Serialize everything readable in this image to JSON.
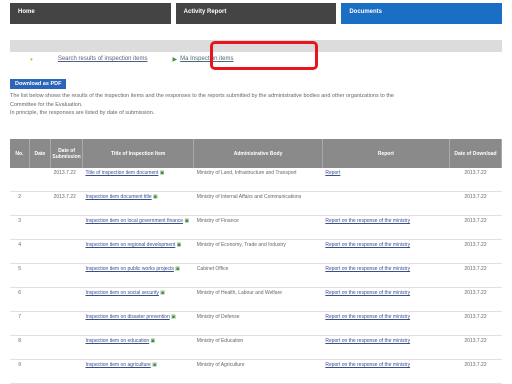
{
  "tabs": [
    {
      "label": "Home"
    },
    {
      "label": "Activity Report"
    },
    {
      "label": "Documents"
    }
  ],
  "links": {
    "link1": "Search results of inspection items",
    "link2": "Ma Inspection items"
  },
  "button": "Download as PDF",
  "desc": {
    "line1": "The list below shows the results of the inspection items and the responses to the reports submitted by the administrative bodies and other organizations to the",
    "line2": "Committee for the Evaluation.",
    "line3": "In principle, the responses are listed by date of submission."
  },
  "table": {
    "headers": [
      "No.",
      "Date",
      "Date of Submission",
      "Title of Inspection Item",
      "Administrative Body",
      "Report",
      "Date of Download"
    ],
    "rows": [
      {
        "no": "",
        "date": "",
        "dt": "2013.7.22",
        "title": "Title of inspection item document",
        "admin": "Ministry of Land, Infrastructure and Transport",
        "report": "Report",
        "dl": "2013.7.22"
      },
      {
        "no": "2",
        "date": "",
        "dt": "2013.7.22",
        "title": "Inspection item document title",
        "admin": "Ministry of Internal Affairs and Communications",
        "report": "",
        "dl": "2013.7.22"
      },
      {
        "no": "3",
        "date": "",
        "dt": "",
        "title": "Inspection item on local government finance",
        "admin": "Ministry of Finance",
        "report": "Report on the response of the ministry",
        "dl": "2013.7.22"
      },
      {
        "no": "4",
        "date": "",
        "dt": "",
        "title": "Inspection item on regional development",
        "admin": "Ministry of Economy, Trade and Industry",
        "report": "Report on the response of the ministry",
        "dl": "2013.7.22"
      },
      {
        "no": "5",
        "date": "",
        "dt": "",
        "title": "Inspection item on public works projects",
        "admin": "Cabinet Office",
        "report": "Report on the response of the ministry",
        "dl": "2013.7.22"
      },
      {
        "no": "6",
        "date": "",
        "dt": "",
        "title": "Inspection item on social security",
        "admin": "Ministry of Health, Labour and Welfare",
        "report": "Report on the response of the ministry",
        "dl": "2013.7.22"
      },
      {
        "no": "7",
        "date": "",
        "dt": "",
        "title": "Inspection item on disaster prevention",
        "admin": "Ministry of Defense",
        "report": "Report on the response of the ministry",
        "dl": "2013.7.22"
      },
      {
        "no": "8",
        "date": "",
        "dt": "",
        "title": "Inspection item on education",
        "admin": "Ministry of Education",
        "report": "Report on the response of the ministry",
        "dl": "2013.7.22"
      },
      {
        "no": "9",
        "date": "",
        "dt": "",
        "title": "Inspection item on agriculture",
        "admin": "Ministry of Agriculture",
        "report": "Report on the response of the ministry",
        "dl": "2013.7.22"
      }
    ]
  }
}
